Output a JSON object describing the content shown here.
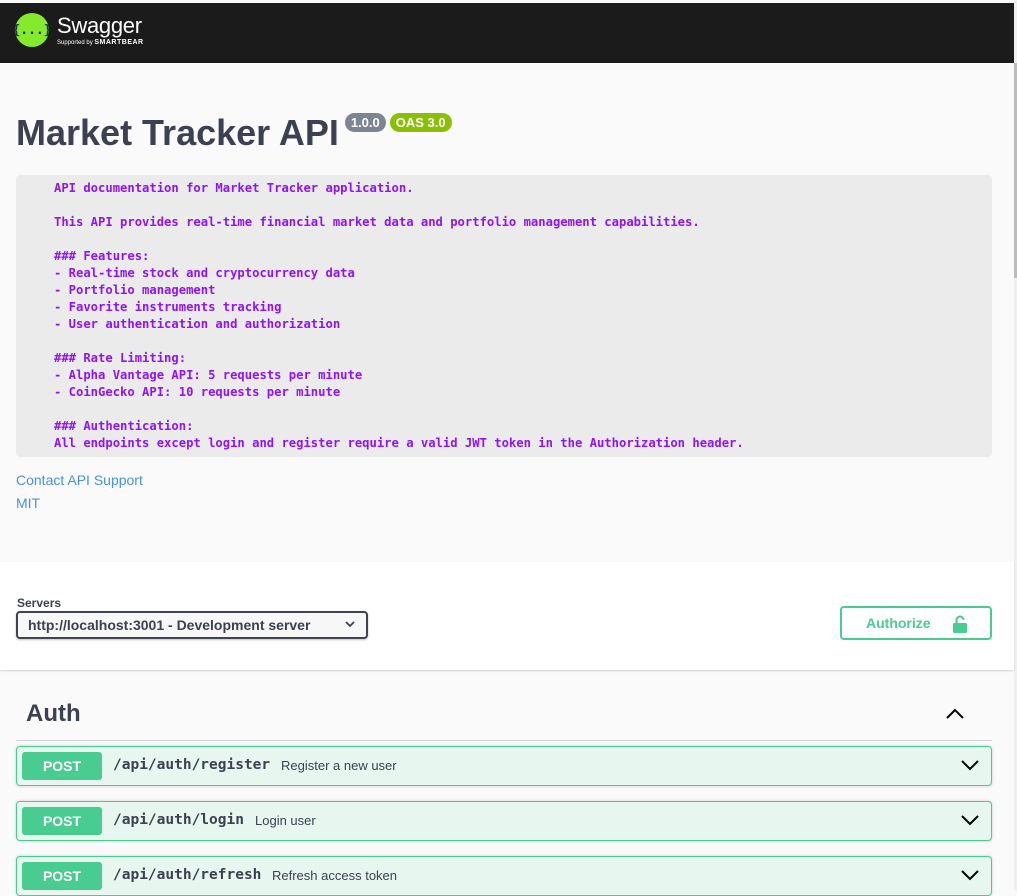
{
  "header": {
    "logo_name": "Swagger",
    "logo_glyph": "{...}",
    "supported_by": "Supported by",
    "smartbear": "SMARTBEAR",
    "logo_color": "#85ea2d",
    "bar_color": "#1b1b1b"
  },
  "info": {
    "title": "Market Tracker API",
    "version": "1.0.0",
    "oas": "OAS 3.0",
    "description": "API documentation for Market Tracker application.\n\nThis API provides real-time financial market data and portfolio management capabilities.\n\n### Features:\n- Real-time stock and cryptocurrency data\n- Portfolio management\n- Favorite instruments tracking\n- User authentication and authorization\n\n### Rate Limiting:\n- Alpha Vantage API: 5 requests per minute\n- CoinGecko API: 10 requests per minute\n\n### Authentication:\nAll endpoints except login and register require a valid JWT token in the Authorization header.",
    "contact_link": "Contact API Support",
    "license_link": "MIT"
  },
  "servers": {
    "label": "Servers",
    "selected": "http://localhost:3001 - Development server"
  },
  "authorize": {
    "label": "Authorize",
    "icon": "lock-open-icon"
  },
  "tag": {
    "name": "Auth",
    "toggle_icon": "chevron-up-icon"
  },
  "operations": [
    {
      "method": "POST",
      "path": "/api/auth/register",
      "summary": "Register a new user"
    },
    {
      "method": "POST",
      "path": "/api/auth/login",
      "summary": "Login user"
    },
    {
      "method": "POST",
      "path": "/api/auth/refresh",
      "summary": "Refresh access token"
    }
  ],
  "colors": {
    "post": "#49cc90",
    "post_bg": "#e8f6f0",
    "description_text": "#9012fe",
    "link": "#4990e2",
    "version_badge": "#7d8492",
    "oas_badge": "#89bf04"
  }
}
